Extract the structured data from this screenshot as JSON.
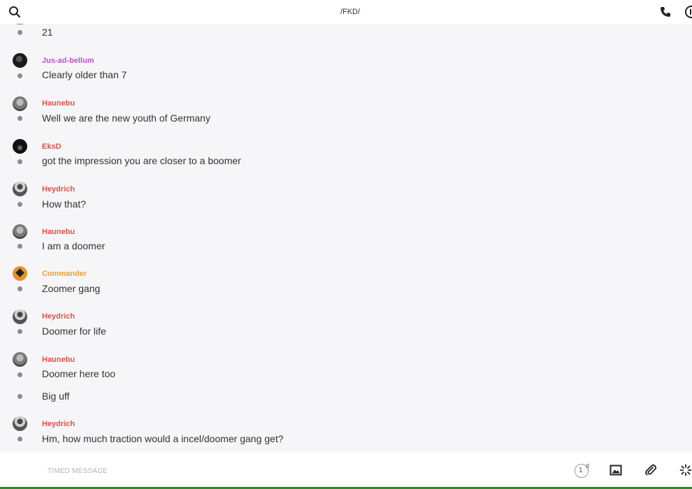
{
  "header": {
    "title": "/FKD/"
  },
  "messages": [
    {
      "sender": "",
      "text": "21"
    },
    {
      "sender": "Jus-ad-bellum",
      "text": "Clearly older than 7"
    },
    {
      "sender": "Haunebu",
      "text": "Well we are the new youth of Germany"
    },
    {
      "sender": "EksD",
      "text": "got the impression you are closer to a boomer"
    },
    {
      "sender": "Heydrich",
      "text": "How that?"
    },
    {
      "sender": "Haunebu",
      "text": "I am a doomer"
    },
    {
      "sender": "Commander",
      "text": "Zoomer gang"
    },
    {
      "sender": "Heydrich",
      "text": "Doomer for life"
    },
    {
      "sender": "Haunebu",
      "text": "Doomer here too"
    },
    {
      "sender": "",
      "text": "Big uff"
    },
    {
      "sender": "Heydrich",
      "text": "Hm, how much traction would a incel/doomer gang get?"
    }
  ],
  "colors": {
    "Jus-ad-bellum": "#c44fd4",
    "Haunebu": "#e0504a",
    "EksD": "#e0504a",
    "Heydrich": "#e0504a",
    "Commander": "#f0a030"
  },
  "composer": {
    "placeholder": "TIMED MESSAGE",
    "timer_value": "1",
    "timer_unit": "d"
  }
}
